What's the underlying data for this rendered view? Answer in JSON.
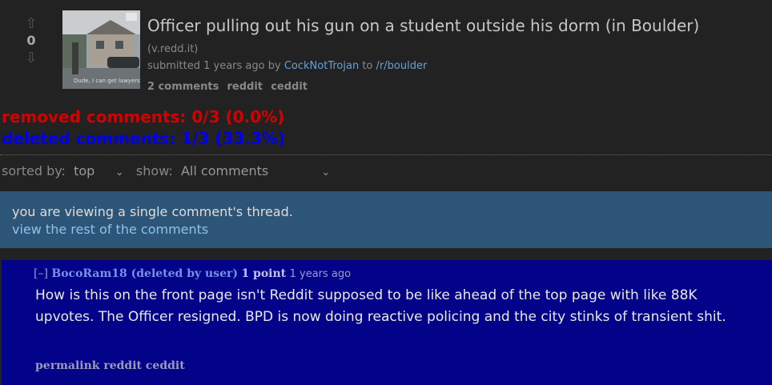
{
  "post": {
    "score": "0",
    "title": "Officer pulling out his gun on a student outside his dorm (in Boulder)",
    "domain": "(v.redd.it)",
    "submitted_prefix": "submitted",
    "submitted_time": "1 years ago",
    "by_word": "by",
    "author": "CockNotTrojan",
    "to_word": "to",
    "subreddit": "/r/boulder",
    "thumbnail_caption": "Dude, I can get lawyers",
    "links": {
      "comments": "2 comments",
      "reddit": "reddit",
      "ceddit": "ceddit"
    }
  },
  "stats": {
    "removed": "removed comments: 0/3 (0.0%)",
    "deleted": "deleted comments: 1/3 (33.3%)",
    "removed_color": "#d40000",
    "deleted_color": "#0000ee"
  },
  "sort": {
    "sorted_label": "sorted by:",
    "sorted_value": "top",
    "show_label": "show:",
    "show_value": "All comments"
  },
  "notice": {
    "text": "you are viewing a single comment's thread.",
    "link": "view the rest of the comments"
  },
  "comment": {
    "collapse": "[–]",
    "author": "BocoRam18 (deleted by user)",
    "points": "1 point",
    "time": "1 years ago",
    "body": "How is this on the front page isn't Reddit supposed to be like ahead of the top page with like 88K upvotes. The Officer resigned. BPD is now doing reactive policing and the city stinks of transient shit.",
    "links": {
      "permalink": "permalink",
      "reddit": "reddit",
      "ceddit": "ceddit"
    },
    "background": "#03038a"
  }
}
